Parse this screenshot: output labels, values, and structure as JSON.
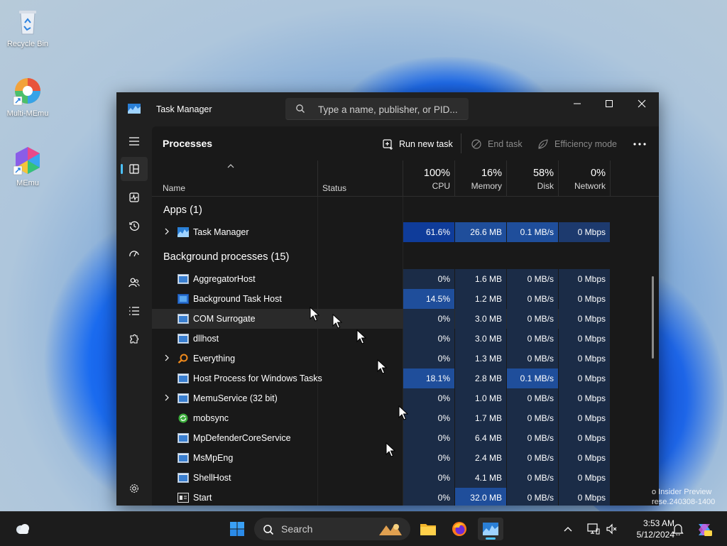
{
  "desktop": {
    "icons": [
      {
        "label": "Recycle Bin"
      },
      {
        "label": "Multi-MEmu"
      },
      {
        "label": "MEmu"
      }
    ],
    "watermark_line1": "o Insider Preview",
    "watermark_line2": "rese.240308-1400"
  },
  "window": {
    "title": "Task Manager",
    "search_placeholder": "Type a name, publisher, or PID..."
  },
  "page": {
    "title": "Processes",
    "run_new_task": "Run new task",
    "end_task": "End task",
    "efficiency_mode": "Efficiency mode"
  },
  "columns": {
    "name": "Name",
    "status": "Status",
    "cpu_pct": "100%",
    "cpu": "CPU",
    "mem_pct": "16%",
    "mem": "Memory",
    "disk_pct": "58%",
    "disk": "Disk",
    "net_pct": "0%",
    "net": "Network"
  },
  "groups": {
    "apps": "Apps (1)",
    "background": "Background processes (15)"
  },
  "apps": [
    {
      "name": "Task Manager",
      "cpu": "61.6%",
      "mem": "26.6 MB",
      "disk": "0.1 MB/s",
      "net": "0 Mbps"
    }
  ],
  "background": [
    {
      "name": "AggregatorHost",
      "cpu": "0%",
      "mem": "1.6 MB",
      "disk": "0 MB/s",
      "net": "0 Mbps"
    },
    {
      "name": "Background Task Host",
      "cpu": "14.5%",
      "mem": "1.2 MB",
      "disk": "0 MB/s",
      "net": "0 Mbps"
    },
    {
      "name": "COM Surrogate",
      "cpu": "0%",
      "mem": "3.0 MB",
      "disk": "0 MB/s",
      "net": "0 Mbps"
    },
    {
      "name": "dllhost",
      "cpu": "0%",
      "mem": "3.0 MB",
      "disk": "0 MB/s",
      "net": "0 Mbps"
    },
    {
      "name": "Everything",
      "cpu": "0%",
      "mem": "1.3 MB",
      "disk": "0 MB/s",
      "net": "0 Mbps"
    },
    {
      "name": "Host Process for Windows Tasks",
      "cpu": "18.1%",
      "mem": "2.8 MB",
      "disk": "0.1 MB/s",
      "net": "0 Mbps"
    },
    {
      "name": "MemuService (32 bit)",
      "cpu": "0%",
      "mem": "1.0 MB",
      "disk": "0 MB/s",
      "net": "0 Mbps"
    },
    {
      "name": "mobsync",
      "cpu": "0%",
      "mem": "1.7 MB",
      "disk": "0 MB/s",
      "net": "0 Mbps"
    },
    {
      "name": "MpDefenderCoreService",
      "cpu": "0%",
      "mem": "6.4 MB",
      "disk": "0 MB/s",
      "net": "0 Mbps"
    },
    {
      "name": "MsMpEng",
      "cpu": "0%",
      "mem": "2.4 MB",
      "disk": "0 MB/s",
      "net": "0 Mbps"
    },
    {
      "name": "ShellHost",
      "cpu": "0%",
      "mem": "4.1 MB",
      "disk": "0 MB/s",
      "net": "0 Mbps"
    },
    {
      "name": "Start",
      "cpu": "0%",
      "mem": "32.0 MB",
      "disk": "0 MB/s",
      "net": "0 Mbps"
    }
  ],
  "taskbar": {
    "search_label": "Search",
    "time": "3:53 AM",
    "date": "5/12/2024"
  }
}
